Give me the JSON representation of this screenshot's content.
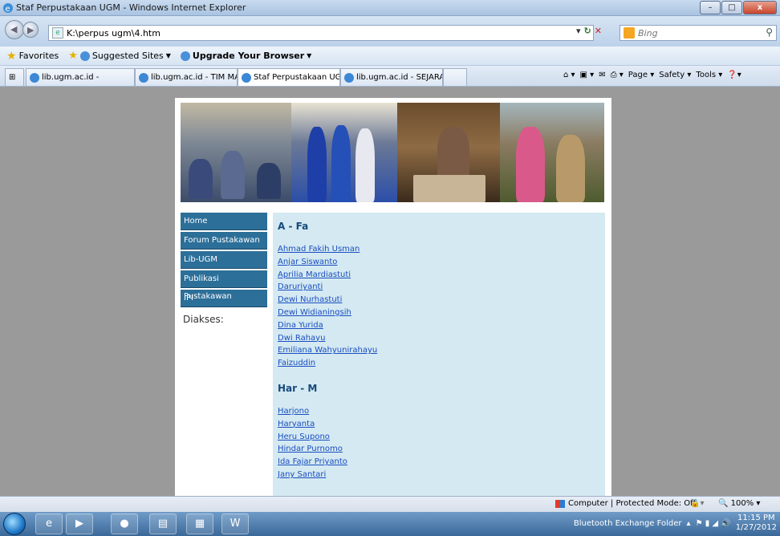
{
  "window": {
    "title": "Staf Perpustakaan UGM - Windows Internet Explorer",
    "minimize": "–",
    "maximize": "□",
    "close": "x"
  },
  "addressbar": {
    "url": "K:\\perpus ugm\\4.htm",
    "search_placeholder": "Bing"
  },
  "favorites": {
    "favorites_label": "Favorites",
    "suggested_label": "Suggested Sites",
    "upgrade_label": "Upgrade Your Browser"
  },
  "tabs": [
    {
      "label": "lib.ugm.ac.id -"
    },
    {
      "label": "lib.ugm.ac.id - TIM MANA..."
    },
    {
      "label": "Staf Perpustakaan UGM"
    },
    {
      "label": "lib.ugm.ac.id - SEJARAH"
    }
  ],
  "tabtools": {
    "page": "Page",
    "safety": "Safety",
    "tools": "Tools"
  },
  "nav": [
    {
      "label": "Home"
    },
    {
      "label": "Forum Pustakawan"
    },
    {
      "label": "Lib-UGM"
    },
    {
      "label": "Publikasi Pustakawan"
    },
    {
      "label": "IPI"
    }
  ],
  "diakses_label": "Diakses:",
  "sections": [
    {
      "heading": "A - Fa",
      "names": [
        "Ahmad Fakih Usman",
        "Anjar Siswanto",
        "Aprilia Mardiastuti",
        "Daruriyanti",
        "Dewi Nurhastuti",
        "Dewi Widianingsih",
        "Dina Yurida",
        "Dwi Rahayu",
        "Emiliana Wahyunirahayu",
        "Faizuddin"
      ]
    },
    {
      "heading": "Har - M",
      "names": [
        "Harjono",
        "Haryanta",
        "Heru Supono",
        "Hindar Purnomo",
        "Ida Fajar Priyanto",
        "Jany Santari"
      ]
    }
  ],
  "statusbar": {
    "zone": "Computer | Protected Mode: Off",
    "zoom": "100%"
  },
  "taskbar": {
    "tray_text": "Bluetooth Exchange Folder",
    "time": "11:15 PM",
    "date": "1/27/2012"
  }
}
